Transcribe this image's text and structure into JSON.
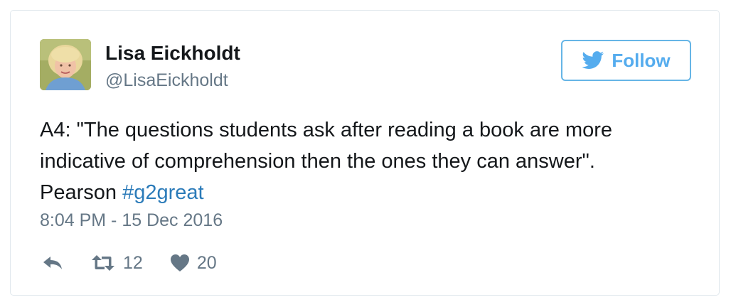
{
  "author": {
    "name": "Lisa Eickholdt",
    "handle": "@LisaEickholdt",
    "avatar_icon": "profile-photo"
  },
  "follow_button": {
    "label": "Follow",
    "icon": "twitter-bird-icon",
    "color": "#55acee"
  },
  "tweet": {
    "text_lines": [
      "A4: \"The questions students ask after reading a book are more",
      "indicative of comprehension then the ones they can answer\".",
      "Pearson "
    ],
    "hashtag": "#g2great",
    "hashtag_color": "#2b7bb9",
    "timestamp": "8:04 PM - 15 Dec 2016"
  },
  "actions": {
    "reply_icon": "reply-arrow-icon",
    "retweet_icon": "retweet-icon",
    "retweet_count": "12",
    "like_icon": "heart-icon",
    "like_count": "20"
  }
}
